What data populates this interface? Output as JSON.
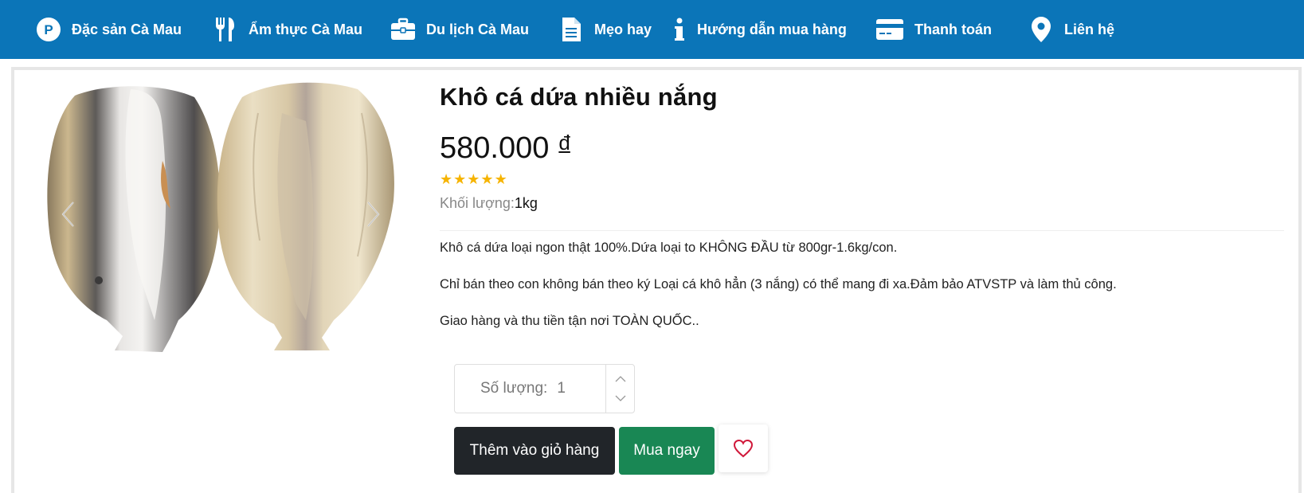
{
  "nav": {
    "items": [
      {
        "label": "Đặc sản Cà Mau",
        "icon": "p-circle-icon"
      },
      {
        "label": "Ẩm thực Cà Mau",
        "icon": "fork-knife-icon"
      },
      {
        "label": "Du lịch Cà Mau",
        "icon": "briefcase-icon"
      },
      {
        "label": "Mẹo hay",
        "icon": "document-icon"
      },
      {
        "label": "Hướng dẫn mua hàng",
        "icon": "info-icon"
      },
      {
        "label": "Thanh toán",
        "icon": "credit-card-icon"
      },
      {
        "label": "Liên hệ",
        "icon": "map-pin-icon"
      }
    ],
    "background": "#0b75b8"
  },
  "product": {
    "title": "Khô cá dứa nhiều nắng",
    "price": "580.000",
    "currency": "đ",
    "rating": 5,
    "rating_max": 5,
    "weight_label": "Khối lượng:",
    "weight_value": "1kg",
    "description": [
      "Khô cá dứa loại ngon thật 100%.Dứa loại to KHÔNG ĐẦU từ 800gr-1.6kg/con.",
      "Chỉ bán theo con không bán theo ký Loại cá khô hẳn (3 nắng) có thể mang đi xa.Đảm bảo ATVSTP và làm thủ công.",
      "Giao hàng và thu tiền tận nơi TOÀN QUỐC.."
    ],
    "star_color": "#f6b400"
  },
  "quantity": {
    "label": "Số lượng:",
    "value": "1"
  },
  "buttons": {
    "add_to_cart": "Thêm vào giỏ hàng",
    "buy_now": "Mua ngay",
    "cart_color": "#212529",
    "buy_color": "#198754",
    "heart_color": "#d0183a"
  }
}
